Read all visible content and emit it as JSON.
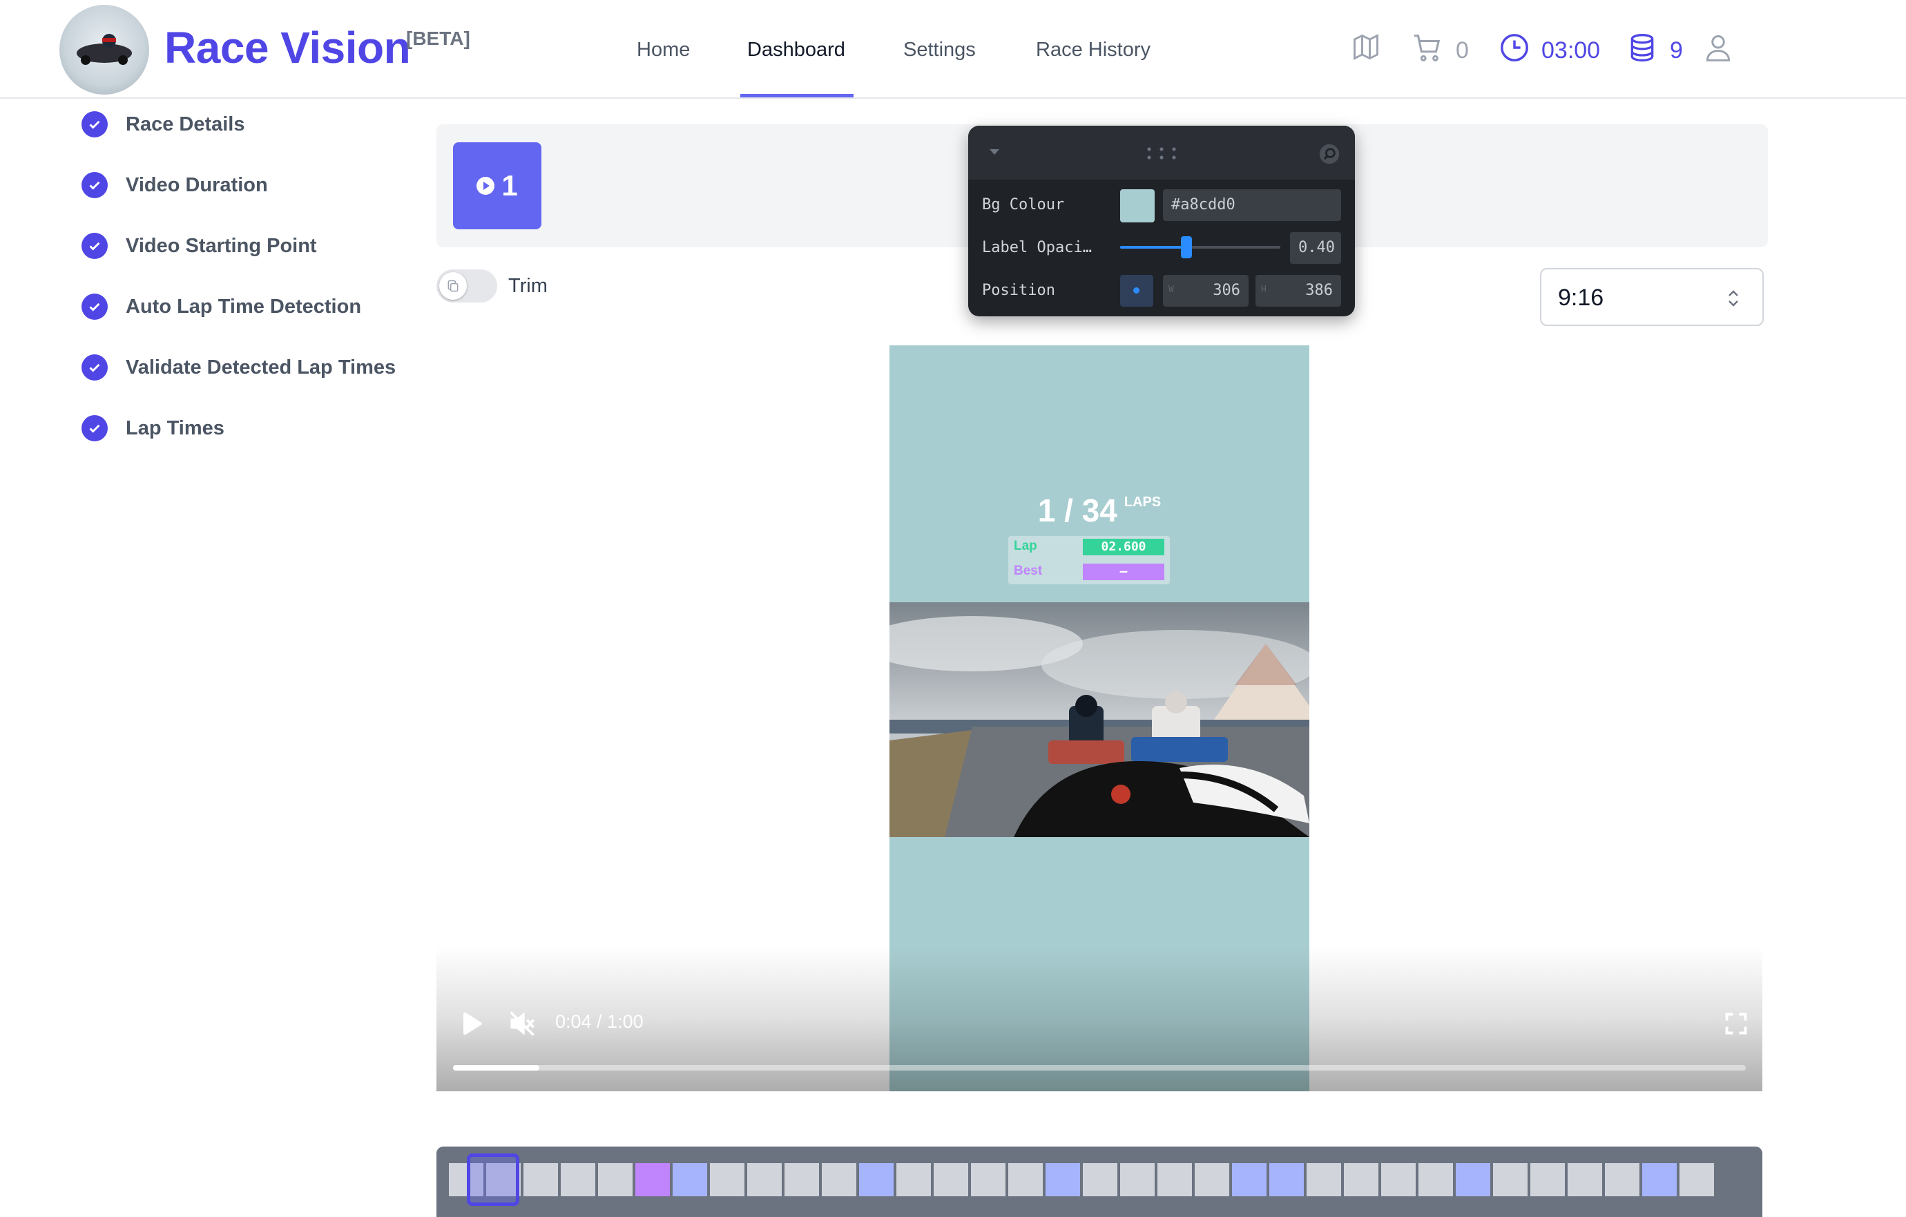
{
  "header": {
    "brand": "Race Vision",
    "beta": "[BETA]",
    "logo_text": "RACE VISION",
    "nav": [
      {
        "label": "Home"
      },
      {
        "label": "Dashboard"
      },
      {
        "label": "Settings"
      },
      {
        "label": "Race History"
      }
    ],
    "active_nav": "Dashboard",
    "cart_count": "0",
    "timer": "03:00",
    "credits": "9",
    "icons": [
      "map-icon",
      "cart-icon",
      "clock-icon",
      "database-icon",
      "user-icon"
    ],
    "accent_color": "#4f46e5"
  },
  "sidebar": {
    "items": [
      {
        "label": "Race Details"
      },
      {
        "label": "Video Duration"
      },
      {
        "label": "Video Starting Point"
      },
      {
        "label": "Auto Lap Time Detection"
      },
      {
        "label": "Validate Detected Lap Times"
      },
      {
        "label": "Lap Times"
      }
    ]
  },
  "segments": {
    "selected_label": "1"
  },
  "trim": {
    "label": "Trim",
    "enabled": false
  },
  "aspect_ratio": {
    "value": "9:16"
  },
  "panel": {
    "bg_colour_label": "Bg Colour",
    "bg_colour_value": "#a8cdd0",
    "label_opacity_label": "Label Opaci…",
    "label_opacity_value": "0.40",
    "position_label": "Position",
    "w_label": "W",
    "w_value": "306",
    "h_label": "H",
    "h_value": "386"
  },
  "video": {
    "background_color": "#a8cdd0",
    "laps_current": "1",
    "laps_total": "34",
    "laps_unit": "LAPS",
    "lap_label": "Lap",
    "lap_value": "02.600",
    "best_label": "Best",
    "best_value": "–",
    "time_display": "0:04 / 1:00",
    "progress_fraction": 0.067
  }
}
